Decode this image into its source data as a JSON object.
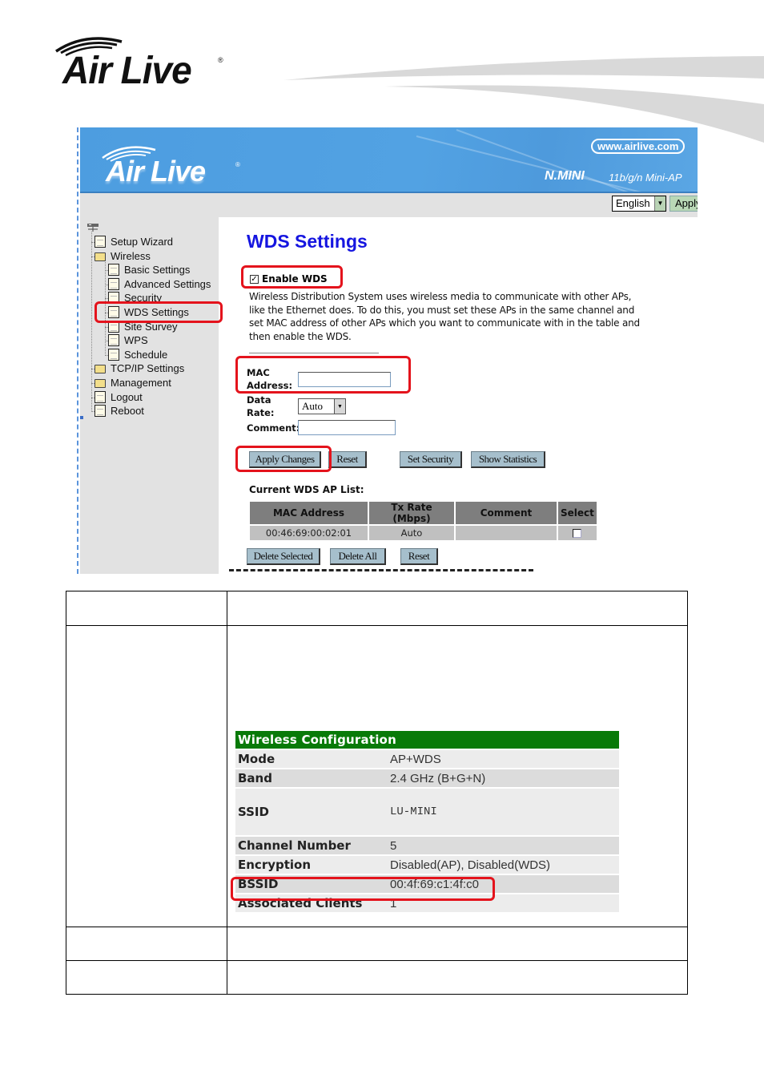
{
  "document": {
    "brand_logo_text": "Air Live",
    "registered_mark": "®"
  },
  "screenshot": {
    "banner": {
      "logo_text": "Air Live",
      "registered_mark": "®",
      "website": "www.airlive.com",
      "product_name": "N.MINI",
      "product_desc": "11b/g/n Mini-AP"
    },
    "toolbar": {
      "language": "English",
      "apply_label": "Apply"
    },
    "sidebar": {
      "items": [
        {
          "label": "Setup Wizard",
          "type": "page",
          "level": 0
        },
        {
          "label": "Wireless",
          "type": "folder-open",
          "level": 0
        },
        {
          "label": "Basic Settings",
          "type": "page",
          "level": 1
        },
        {
          "label": "Advanced Settings",
          "type": "page",
          "level": 1
        },
        {
          "label": "Security",
          "type": "page",
          "level": 1
        },
        {
          "label": "WDS Settings",
          "type": "page",
          "level": 1,
          "selected": true
        },
        {
          "label": "Site Survey",
          "type": "page",
          "level": 1
        },
        {
          "label": "WPS",
          "type": "page",
          "level": 1
        },
        {
          "label": "Schedule",
          "type": "page",
          "level": 1
        },
        {
          "label": "TCP/IP Settings",
          "type": "folder",
          "level": 0
        },
        {
          "label": "Management",
          "type": "folder",
          "level": 0
        },
        {
          "label": "Logout",
          "type": "page",
          "level": 0
        },
        {
          "label": "Reboot",
          "type": "page",
          "level": 0
        }
      ]
    },
    "main": {
      "title": "WDS Settings",
      "enable_wds_label": "Enable WDS",
      "enable_wds_checked": true,
      "description": "Wireless Distribution System uses wireless media to communicate with other APs, like the Ethernet does. To do this, you must set these APs in the same channel and set MAC address of other APs which you want to communicate with in the table and then enable the WDS.",
      "form": {
        "mac_label_line1": "MAC",
        "mac_label_line2": "Address:",
        "mac_value": "",
        "rate_label_line1": "Data",
        "rate_label_line2": "Rate:",
        "rate_value": "Auto",
        "comment_label": "Comment:",
        "comment_value": ""
      },
      "buttons": {
        "apply": "Apply Changes",
        "reset": "Reset",
        "set_security": "Set Security",
        "show_statistics": "Show Statistics"
      },
      "ap_list": {
        "title": "Current WDS AP List:",
        "columns": [
          "MAC Address",
          "Tx Rate (Mbps)",
          "Comment",
          "Select"
        ],
        "rows": [
          {
            "mac": "00:46:69:00:02:01",
            "tx_rate": "Auto",
            "comment": "",
            "selected": false
          }
        ]
      },
      "list_buttons": {
        "delete_selected": "Delete Selected",
        "delete_all": "Delete All",
        "reset": "Reset"
      }
    }
  },
  "wireless_config": {
    "title": "Wireless  Configuration",
    "rows": [
      {
        "key": "Mode",
        "value": "AP+WDS"
      },
      {
        "key": "Band",
        "value": "2.4 GHz (B+G+N)"
      },
      {
        "key": "SSID",
        "value": "LU-MINI"
      },
      {
        "key": "Channel Number",
        "value": "5"
      },
      {
        "key": "Encryption",
        "value": "Disabled(AP), Disabled(WDS)"
      },
      {
        "key": "BSSID",
        "value": "00:4f:69:c1:4f:c0"
      },
      {
        "key": "Associated Clients",
        "value": "1"
      }
    ]
  },
  "colors": {
    "banner_blue": "#4f9ee0",
    "title_blue": "#1515e0",
    "highlight_red": "#e4131c",
    "config_header_green": "#087a08",
    "button_steel": "#a6bfcc"
  }
}
